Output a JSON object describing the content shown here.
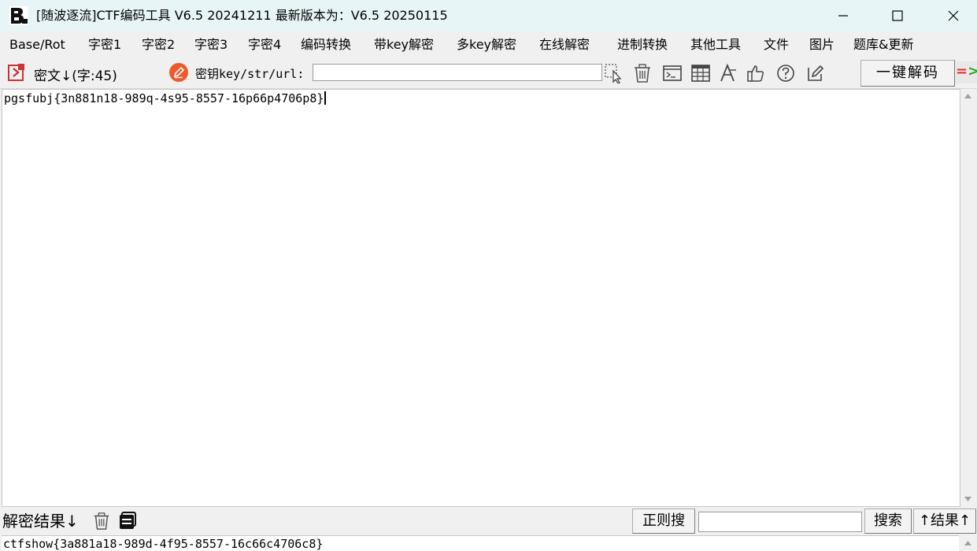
{
  "window": {
    "title": "[随波逐流]CTF编码工具 V6.5 20241211     最新版本为：V6.5 20250115",
    "logo": "B",
    "minimize_icon": "minimize-icon",
    "maximize_icon": "maximize-icon",
    "close_icon": "close-icon"
  },
  "menu": {
    "items": [
      {
        "label": "Base/Rot"
      },
      {
        "label": "字密1"
      },
      {
        "label": "字密2"
      },
      {
        "label": "字密3"
      },
      {
        "label": "字密4"
      },
      {
        "label": "编码转换"
      },
      {
        "label": "带key解密"
      },
      {
        "label": "多key解密"
      },
      {
        "label": "在线解密"
      },
      {
        "label": "进制转换"
      },
      {
        "label": "其他工具"
      },
      {
        "label": "文件"
      },
      {
        "label": "图片"
      },
      {
        "label": "题库&更新"
      }
    ]
  },
  "toolbar": {
    "cipher_label": "密文↓(字:45)",
    "key_label": "密钥key/str/url:",
    "key_value": "",
    "decode_button": "一键解码",
    "indicator_text": "=>",
    "icons": [
      "select-icon",
      "trash-icon",
      "terminal-icon",
      "table-icon",
      "font-icon",
      "thumbs-up-icon",
      "help-icon",
      "edit-icon"
    ]
  },
  "editor": {
    "ciphertext": "pgsfubj{3n881n18-989q-4s95-8557-16p66p4706p8}"
  },
  "bottom": {
    "result_label": "解密结果↓",
    "regex_search_button": "正则搜",
    "search_value": "",
    "search_button": "搜索",
    "result_up_button": "↑结果↑"
  },
  "result": {
    "text": "ctfshow{3a881a18-989d-4f95-8557-16c66c4706c8}"
  },
  "colors": {
    "titlebar": "#e8f5f6",
    "accent_red": "#e03030",
    "accent_green": "#22aa22"
  }
}
